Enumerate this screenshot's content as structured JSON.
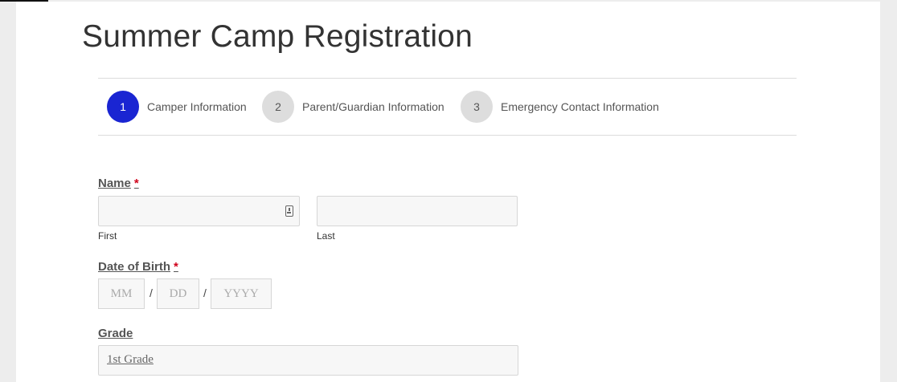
{
  "form": {
    "title": "Summer Camp Registration",
    "steps": [
      {
        "number": "1",
        "label": "Camper Information",
        "active": true
      },
      {
        "number": "2",
        "label": "Parent/Guardian Information",
        "active": false
      },
      {
        "number": "3",
        "label": "Emergency Contact Information",
        "active": false
      }
    ],
    "name": {
      "label": "Name",
      "required_mark": "*",
      "first_sublabel": "First",
      "last_sublabel": "Last"
    },
    "dob": {
      "label": "Date of Birth",
      "required_mark": "*",
      "mm_placeholder": "MM",
      "dd_placeholder": "DD",
      "yyyy_placeholder": "YYYY",
      "separator": "/"
    },
    "grade": {
      "label": "Grade",
      "selected": "1st Grade"
    }
  },
  "colors": {
    "active_step": "#1a25d2",
    "inactive_step": "#dddddd",
    "required": "#d0021b"
  }
}
